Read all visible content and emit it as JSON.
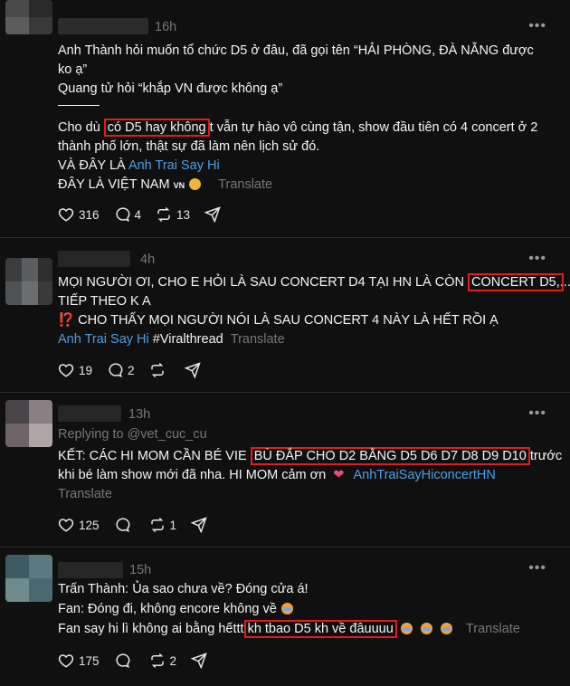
{
  "posts": [
    {
      "time": "16h",
      "lines": [
        "Anh Thành hỏi muốn tổ chức D5 ở đâu, đã gọi tên “HẢI PHÒNG, ĐÀ NẴNG được",
        "ko ạ”",
        "Quang tử hỏi “khắp VN được không ạ”",
        "Cho dù",
        "có D5 hay không",
        "t vẫn tự hào vô cùng tận, show đầu tiên có 4 concert ở 2",
        "thành phố lớn, thật sự đã làm nên lịch sử đó.",
        "VÀ ĐÂY LÀ",
        "Anh Trai Say Hi",
        "ĐÂY LÀ VIỆT NAM",
        "VN"
      ],
      "translate": "Translate",
      "likes": "316",
      "replies": "4",
      "reposts": "13"
    },
    {
      "time": "4h",
      "lines": [
        "MỌI NGƯỜI ƠI, CHO E HỎI LÀ SAU CONCERT D4 TẠI HN LÀ CÒN",
        "CONCERT D5,",
        "...",
        "TIẾP THEO K A",
        "⁉️",
        "CHO THẤY MỌI NGƯỜI NÓI LÀ SAU CONCERT 4 NÀY LÀ HẾT RỒI Ạ",
        "Anh Trai Say Hi",
        "#Viralthread"
      ],
      "translate": "Translate",
      "likes": "19",
      "replies": "2"
    },
    {
      "time": "13h",
      "replying_to": "Replying to @vet_cuc_cu",
      "lines": [
        "KẾT: CÁC HI MOM CẦN BÉ VIE",
        "BÙ ĐẮP CHO D2 BẰNG D5 D6 D7 D8 D9 D10",
        "trước",
        "khi bé làm show mới đã nha. HI MOM cảm ơn",
        "AnhTraiSayHiconcertHN"
      ],
      "translate": "Translate",
      "likes": "125",
      "reposts": "1"
    },
    {
      "time": "15h",
      "lines": [
        "Trấn Thành: Ủa sao chưa về? Đóng cửa á!",
        "Fan: Đóng đi, không encore không về",
        "Fan say hi lì không ai bằng hếttt",
        "kh tbao D5 kh về đâuuuu"
      ],
      "translate": "Translate",
      "likes": "175",
      "reposts": "2"
    }
  ],
  "icons": [
    "heart-icon",
    "comment-icon",
    "repost-icon",
    "share-icon",
    "more-icon"
  ],
  "colors": {
    "background": "#101010",
    "text": "#f3f5f7",
    "link": "#4e9ee6",
    "muted": "#777777",
    "highlight": "#e11c1c"
  }
}
